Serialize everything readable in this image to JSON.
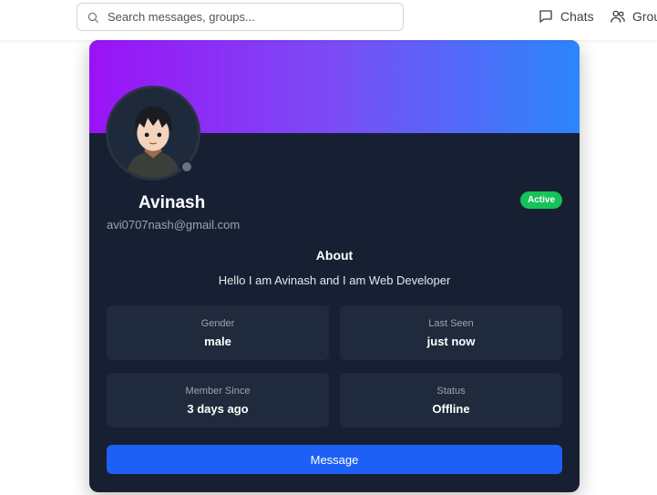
{
  "search": {
    "placeholder": "Search messages, groups..."
  },
  "nav": [
    {
      "label": "Chats",
      "icon": "chat-icon"
    },
    {
      "label": "Grou",
      "icon": "groups-icon"
    }
  ],
  "profile": {
    "name": "Avinash",
    "email": "avi0707nash@gmail.com",
    "badge": "Active",
    "about_title": "About",
    "about_text": "Hello I am Avinash and I am Web Developer",
    "presence_color": "#6b7280",
    "banner_colors": [
      "#9b12f7",
      "#7b4cf5",
      "#2b86fb"
    ]
  },
  "details": [
    {
      "label": "Gender",
      "value": "male"
    },
    {
      "label": "Last Seen",
      "value": "just now"
    },
    {
      "label": "Member Since",
      "value": "3 days ago"
    },
    {
      "label": "Status",
      "value": "Offline"
    }
  ],
  "actions": {
    "message_label": "Message"
  }
}
